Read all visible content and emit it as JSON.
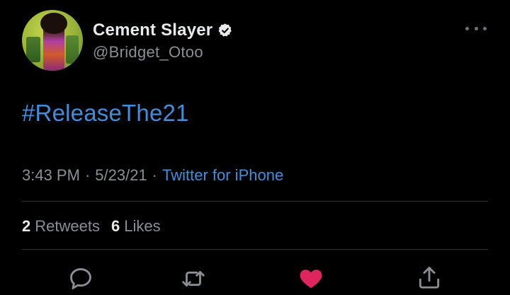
{
  "author": {
    "display_name": "Cement Slayer",
    "handle": "@Bridget_Otoo",
    "verified_icon": "verified-badge-icon"
  },
  "tweet": {
    "text": "#ReleaseThe21",
    "time": "3:43 PM",
    "date": "5/23/21",
    "separator": "·",
    "source": "Twitter for iPhone"
  },
  "stats": {
    "retweets_count": "2",
    "retweets_label": "Retweets",
    "likes_count": "6",
    "likes_label": "Likes"
  },
  "actions": {
    "reply": "reply-icon",
    "retweet": "retweet-icon",
    "like": "heart-icon",
    "share": "share-icon"
  },
  "colors": {
    "background": "#000000",
    "link": "#3f8fdc",
    "liked": "#e0245e",
    "secondary_text": "#8b8f94"
  }
}
